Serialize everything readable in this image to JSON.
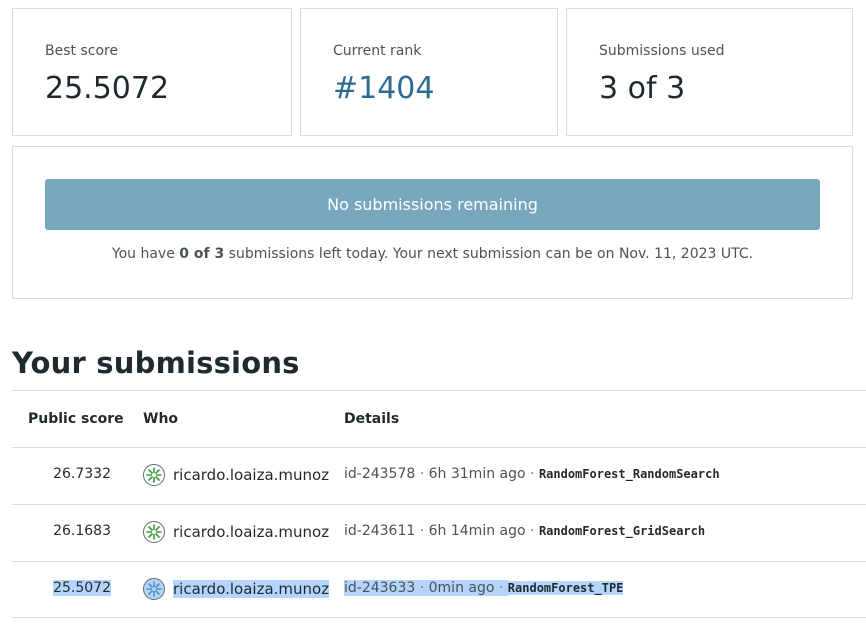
{
  "stats": {
    "best_score": {
      "label": "Best score",
      "value": "25.5072"
    },
    "current_rank": {
      "label": "Current rank",
      "value": "#1404"
    },
    "submissions_used": {
      "label": "Submissions used",
      "value": "3 of 3"
    }
  },
  "status": {
    "button_label": "No submissions remaining",
    "msg_prefix": "You have ",
    "msg_count": "0 of 3",
    "msg_suffix": " submissions left today. Your next submission can be on Nov. 11, 2023 UTC."
  },
  "submissions": {
    "title": "Your submissions",
    "columns": [
      "Public score",
      "Who",
      "Details"
    ],
    "rows": [
      {
        "score": "26.7332",
        "who": "ricardo.loaiza.munoz",
        "id": "id-243578",
        "time": "6h 31min ago",
        "name": "RandomForest_RandomSearch"
      },
      {
        "score": "26.1683",
        "who": "ricardo.loaiza.munoz",
        "id": "id-243611",
        "time": "6h 14min ago",
        "name": "RandomForest_GridSearch"
      },
      {
        "score": "25.5072",
        "who": "ricardo.loaiza.munoz",
        "id": "id-243633",
        "time": "0min ago",
        "name": "RandomForest_TPE"
      }
    ]
  },
  "colors": {
    "accent": "#2d6b92",
    "disabled_button": "#78a7bd",
    "selection": "#b4d4fb",
    "avatar_green": "#3f9a3f"
  },
  "icons": {
    "avatar": "star-burst-avatar-icon"
  }
}
